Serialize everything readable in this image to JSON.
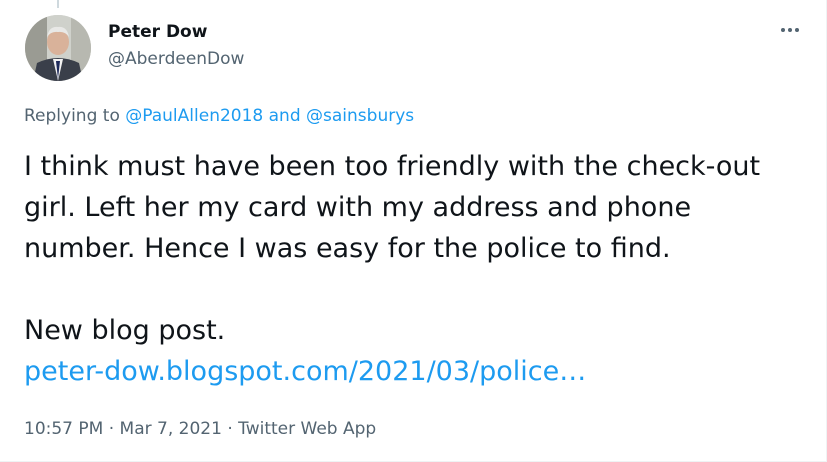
{
  "author": {
    "display_name": "Peter Dow",
    "handle": "@AberdeenDow",
    "avatar_icon": "profile-photo"
  },
  "more_icon": "more-options-icon",
  "reply": {
    "prefix": "Replying to ",
    "first_mention": "@PaulAllen2018",
    "connector": " and ",
    "second_mention": "@sainsburys"
  },
  "tweet": {
    "text_line_1": "I think must have been too friendly with the check-out girl. Left her my card with my address and phone number. Hence I was easy for the police to find.",
    "text_line_2": "New blog post.",
    "link_text": "peter-dow.blogspot.com/2021/03/police…"
  },
  "meta": {
    "time": "10:57 PM",
    "separator_1": " · ",
    "date": "Mar 7, 2021",
    "separator_2": " · ",
    "source": "Twitter Web App"
  },
  "colors": {
    "link": "#1d9bf0",
    "secondary_text": "#536471",
    "primary_text": "#0f1419"
  }
}
